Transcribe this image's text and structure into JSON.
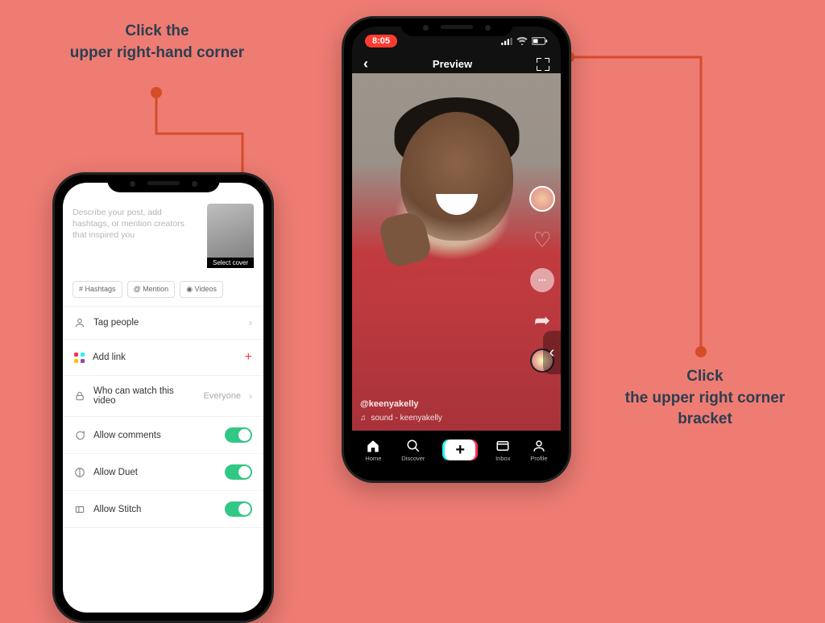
{
  "annotations": {
    "left_line1": "Click the",
    "left_line2": "upper right-hand corner",
    "right_line1": "Click",
    "right_line2": "the upper right corner",
    "right_line3": "bracket"
  },
  "left_phone": {
    "caption_placeholder": "Describe your post, add hashtags, or mention creators that inspired you",
    "cover_label": "Select cover",
    "chips": {
      "hashtags": "# Hashtags",
      "mention": "@ Mention",
      "videos": "◉ Videos"
    },
    "rows": {
      "tag_people": "Tag people",
      "add_link": "Add link",
      "who": "Who can watch this video",
      "who_value": "Everyone",
      "allow_comments": "Allow comments",
      "allow_duet": "Allow Duet",
      "allow_stitch": "Allow Stitch"
    }
  },
  "right_phone": {
    "time": "8:05",
    "title": "Preview",
    "username": "@keenyakelly",
    "sound": "sound - keenyakelly",
    "tabs": {
      "home": "Home",
      "discover": "Discover",
      "inbox": "Inbox",
      "profile": "Profile"
    }
  }
}
